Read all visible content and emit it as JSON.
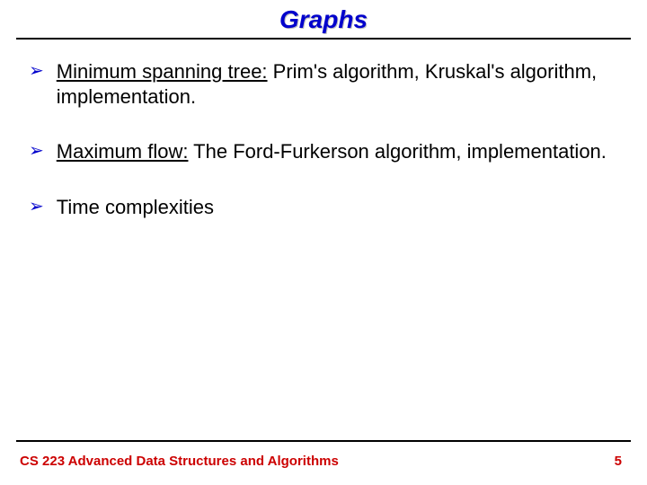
{
  "title": "Graphs",
  "bullets": [
    {
      "lead": "Minimum spanning tree:",
      "rest": " Prim's algorithm, Kruskal's algorithm, implementation."
    },
    {
      "lead": "Maximum flow:",
      "rest": " The Ford-Furkerson algorithm, implementation."
    },
    {
      "lead": "",
      "rest": "Time complexities"
    }
  ],
  "footer": "CS 223 Advanced Data Structures and Algorithms",
  "page": "5",
  "glyphs": {
    "bullet": "➢"
  }
}
